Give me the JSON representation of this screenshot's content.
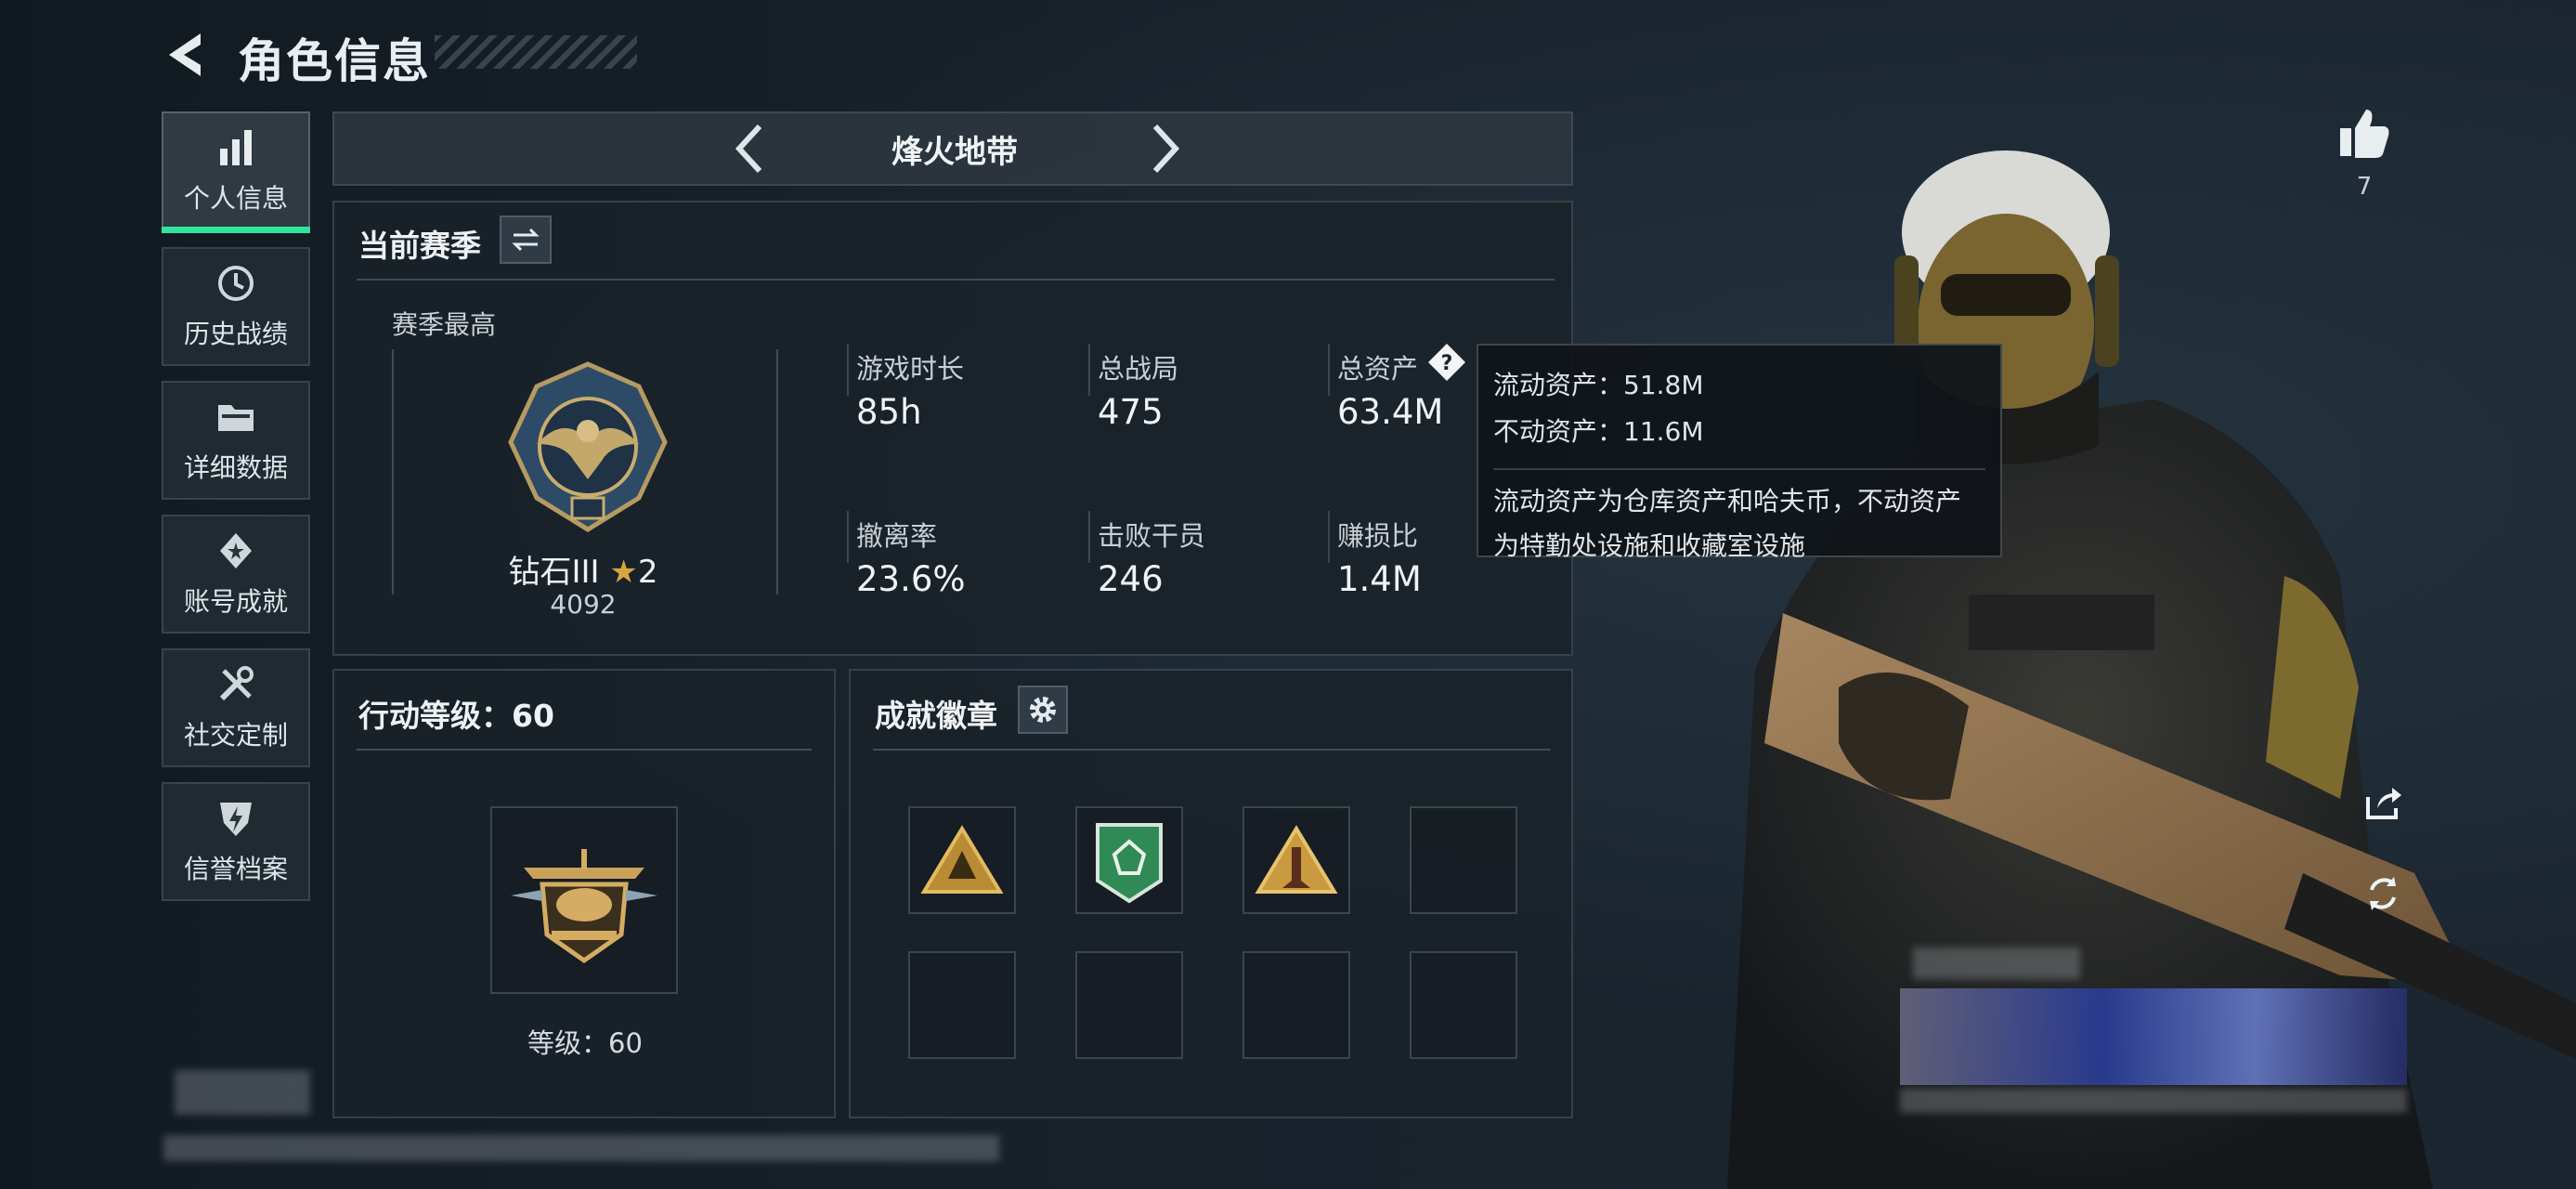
{
  "header": {
    "title": "角色信息"
  },
  "sidebar": {
    "items": [
      {
        "label": "个人信息",
        "icon": "bar-chart-icon",
        "active": true
      },
      {
        "label": "历史战绩",
        "icon": "history-clock-icon"
      },
      {
        "label": "详细数据",
        "icon": "folder-icon"
      },
      {
        "label": "账号成就",
        "icon": "medal-icon"
      },
      {
        "label": "社交定制",
        "icon": "tools-icon"
      },
      {
        "label": "信誉档案",
        "icon": "shield-bolt-icon"
      }
    ]
  },
  "mode_nav": {
    "title": "烽火地带"
  },
  "season": {
    "title": "当前赛季",
    "best_label": "赛季最高",
    "rank_name": "钻石III",
    "rank_stars": "2",
    "rank_points": "4092",
    "stats": [
      {
        "label": "游戏时长",
        "value": "85h"
      },
      {
        "label": "总战局",
        "value": "475"
      },
      {
        "label": "总资产",
        "value": "63.4M"
      },
      {
        "label": "撤离率",
        "value": "23.6%"
      },
      {
        "label": "击败干员",
        "value": "246"
      },
      {
        "label": "赚损比",
        "value": "1.4M"
      }
    ]
  },
  "tooltip": {
    "liquid": "流动资产：51.8M",
    "fixed": "不动资产：11.6M",
    "desc_line1": "流动资产为仓库资产和哈夫币，不动资产",
    "desc_line2": "为特勤处设施和收藏室设施"
  },
  "action_level": {
    "title": "行动等级：60",
    "level_text": "等级：60"
  },
  "achievements": {
    "title": "成就徽章",
    "badges": [
      "gold-triangle-badge-icon",
      "green-shield-badge-icon",
      "gold-rocket-badge-icon",
      "",
      "",
      "",
      "",
      ""
    ]
  },
  "right": {
    "like_count": "7"
  },
  "colors": {
    "accent": "#2fe59b",
    "gold": "#d7a640",
    "green_badge": "#2f8a55"
  }
}
